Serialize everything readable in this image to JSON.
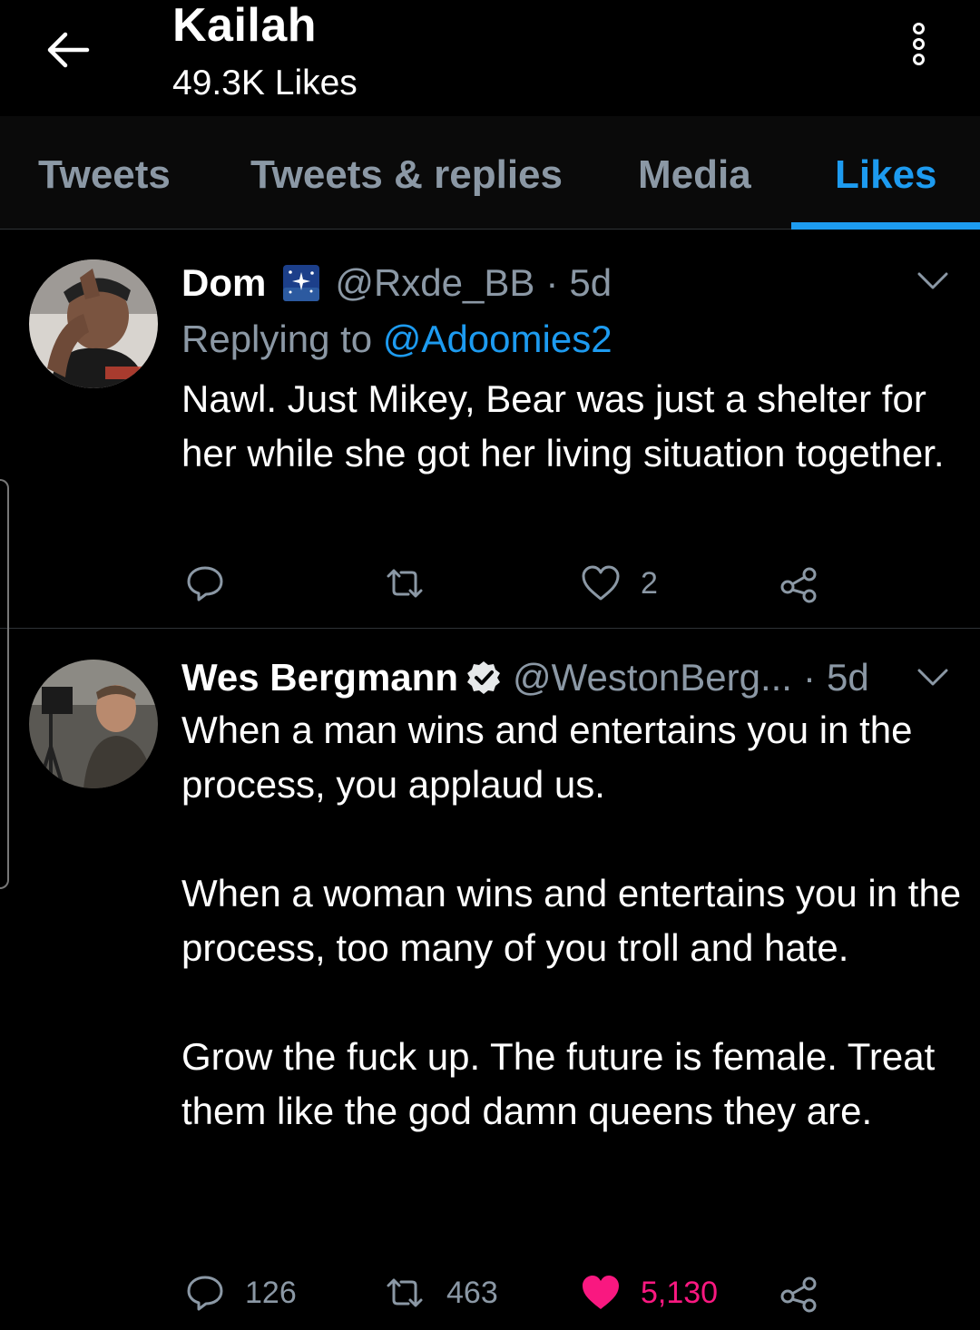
{
  "header": {
    "title": "Kailah",
    "subtitle": "49.3K Likes"
  },
  "tabs": [
    {
      "label": "Tweets",
      "active": false
    },
    {
      "label": "Tweets & replies",
      "active": false
    },
    {
      "label": "Media",
      "active": false
    },
    {
      "label": "Likes",
      "active": true
    }
  ],
  "colors": {
    "accent": "#1d9bf0",
    "like": "#f91880",
    "muted": "#8b98a5",
    "background": "#000000"
  },
  "tweets": [
    {
      "name": "Dom",
      "name_badge_icon": "night-sky-emoji-icon",
      "handle": "@Rxde_BB",
      "separator": "·",
      "time": "5d",
      "replying_prefix": "Replying to",
      "replying_to": "@Adoomies2",
      "text": "Nawl. Just Mikey, Bear was just a shelter for her while she got her living situation together.",
      "replies": "",
      "retweets": "",
      "likes": "2",
      "liked": false
    },
    {
      "name": "Wes Bergmann",
      "verified": true,
      "handle": "@WestonBerg...",
      "separator": "·",
      "time": "5d",
      "text": "When a man wins and entertains you in the process, you applaud us.\n\nWhen a woman wins and entertains you in the process, too many of you troll and hate.\n\nGrow the fuck up. The future is female. Treat them like the god damn queens they are.",
      "replies": "126",
      "retweets": "463",
      "likes": "5,130",
      "liked": true
    }
  ]
}
